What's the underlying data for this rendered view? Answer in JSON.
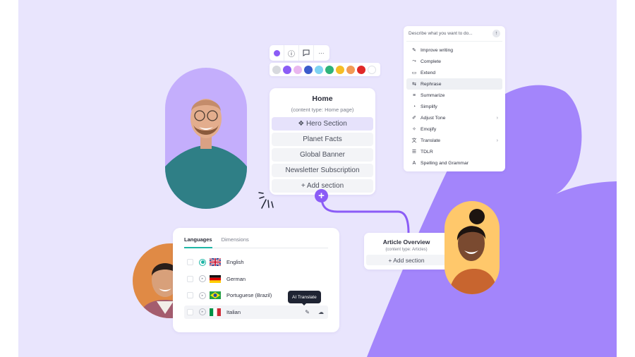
{
  "colors": {
    "canvas_bg": "#e9e5fd",
    "blob": "#a385fb",
    "accent_purple": "#8b5cf6",
    "teal": "#1fb6a6",
    "tooltip_bg": "#1f2433"
  },
  "toolbar": {
    "items": [
      {
        "icon": "color-dot-icon"
      },
      {
        "icon": "info-icon",
        "glyph": "ⓘ"
      },
      {
        "icon": "comment-icon"
      },
      {
        "icon": "more-icon",
        "glyph": "···"
      }
    ],
    "palette": [
      "#d7d9de",
      "#8b5cf6",
      "#e9b7ef",
      "#3b5bcc",
      "#7ed3f2",
      "#2eb37a",
      "#f5bd26",
      "#f29a55",
      "#e02828",
      "#ffffff"
    ]
  },
  "home_card": {
    "title": "Home",
    "subtitle": "(content type: Home page)",
    "sections": [
      {
        "label": "❖ Hero Section",
        "active": true
      },
      {
        "label": "Planet Facts"
      },
      {
        "label": "Global Banner"
      },
      {
        "label": "Newsletter Subscription"
      }
    ],
    "add_label": "+ Add section",
    "plus_glyph": "+"
  },
  "ai_menu": {
    "placeholder": "Describe what you want to do...",
    "send_glyph": "↑",
    "items": [
      {
        "label": "Improve writing",
        "icon": "✎",
        "chevron": ""
      },
      {
        "label": "Complete",
        "icon": "⤳",
        "chevron": ""
      },
      {
        "label": "Extend",
        "icon": "▭",
        "chevron": ""
      },
      {
        "label": "Rephrase",
        "icon": "⇆",
        "chevron": ""
      },
      {
        "label": "Summarize",
        "icon": "≡",
        "chevron": ""
      },
      {
        "label": "Simplify",
        "icon": "◔",
        "chevron": ""
      },
      {
        "label": "Adjust Tone",
        "icon": "✐",
        "chevron": "›"
      },
      {
        "label": "Emojify",
        "icon": "✧",
        "chevron": ""
      },
      {
        "label": "Translate",
        "icon": "文",
        "chevron": "›"
      },
      {
        "label": "TDLR",
        "icon": "☰",
        "chevron": ""
      },
      {
        "label": "Spelling and Grammar",
        "icon": "A",
        "chevron": ""
      }
    ],
    "highlighted_index": 3
  },
  "languages_card": {
    "tabs": [
      {
        "label": "Languages",
        "active": true
      },
      {
        "label": "Dimensions",
        "active": false
      }
    ],
    "rows": [
      {
        "name": "English",
        "flag": "uk",
        "selected": true
      },
      {
        "name": "German",
        "flag": "de",
        "selected": false
      },
      {
        "name": "Portuguese (Brazil)",
        "flag": "br",
        "selected": false
      },
      {
        "name": "Italian",
        "flag": "it",
        "selected": false
      }
    ],
    "tooltip": "AI Translate",
    "row_actions": {
      "ai_translate_glyph": "✎",
      "upload_glyph": "☁"
    }
  },
  "article_card": {
    "title": "Article Overview",
    "subtitle": "(content type: Articles)",
    "add_label": "+ Add section"
  },
  "portraits": [
    {
      "name": "man-glasses",
      "bg": "#c4aefc"
    },
    {
      "name": "young-man",
      "bg": "#e08a45"
    },
    {
      "name": "woman-smiling",
      "bg": "#ffc86b"
    }
  ]
}
